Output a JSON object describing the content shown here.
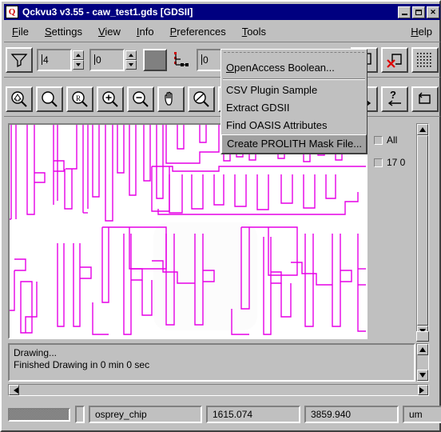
{
  "window": {
    "title": "Qckvu3 v3.55 - caw_test1.gds [GDSII]",
    "icon": "app-icon",
    "buttons": {
      "minimize": "_",
      "maximize": "□",
      "close": "✕"
    }
  },
  "menubar": {
    "items": [
      {
        "label": "File",
        "mnemonic": "F"
      },
      {
        "label": "Settings",
        "mnemonic": "S"
      },
      {
        "label": "View",
        "mnemonic": "V"
      },
      {
        "label": "Info",
        "mnemonic": "I"
      },
      {
        "label": "Preferences",
        "mnemonic": "P"
      },
      {
        "label": "Tools",
        "mnemonic": "T"
      }
    ],
    "help": {
      "label": "Help",
      "mnemonic": "H"
    }
  },
  "dropdown": {
    "open_for": "Tools",
    "items": [
      {
        "label": "OpenAccess Boolean...",
        "selected": false
      },
      {
        "label": "CSV Plugin Sample",
        "selected": false
      },
      {
        "label": "Extract GDSII",
        "selected": false
      },
      {
        "label": "Find OASIS Attributes",
        "selected": false
      },
      {
        "label": "Create PROLITH Mask File...",
        "selected": true
      }
    ]
  },
  "toolbar_top": {
    "filter_button": "filter-icon",
    "depth_field": {
      "value": "4"
    },
    "level_field": {
      "value": "0"
    },
    "color_swatch": "#808080",
    "hierarchy_icon": "hierarchy-icon",
    "hier_field": {
      "value": "0"
    },
    "clear_box_button": "clear-box-icon",
    "clear_poly_button": "clear-polygon-icon",
    "grid_button": "grid-icon"
  },
  "toolbar_zoom": {
    "buttons": [
      "zoom-home-icon",
      "zoom-select-icon",
      "zoom-previous-icon",
      "zoom-in-icon",
      "zoom-out-icon",
      "pan-hand-icon",
      "zoom-fit-icon",
      "zoom-extent-icon",
      "measure-right-icon",
      "measure-left-icon",
      "cycle-icon"
    ]
  },
  "layer_panel": {
    "checkboxes": [
      {
        "label": "All",
        "checked": false
      },
      {
        "label": "17 0",
        "checked": false
      }
    ]
  },
  "messages": {
    "lines": [
      "Drawing...",
      "Finished Drawing in 0 min 0 sec"
    ],
    "line1": "Drawing...",
    "line2": "Finished Drawing in 0 min 0 sec"
  },
  "statusbar": {
    "progress_label": "",
    "cell_name": "osprey_chip",
    "coord_x": "1615.074",
    "coord_y": "3859.940",
    "units": "um"
  },
  "canvas": {
    "background": "#ffffff",
    "geometry_color": "#e600e6",
    "layer": "17 0"
  }
}
